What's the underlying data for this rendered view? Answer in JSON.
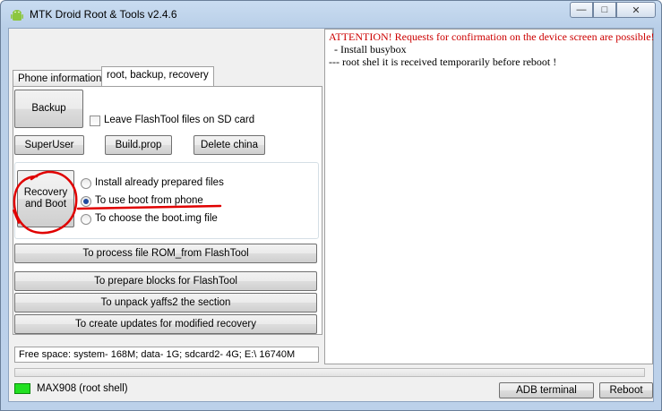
{
  "window": {
    "title": "MTK Droid Root & Tools v2.4.6"
  },
  "caption": {
    "minimize": "—",
    "maximize": "□",
    "close": "✕"
  },
  "tabs": [
    {
      "label": "Phone information"
    },
    {
      "label": "root, backup, recovery"
    }
  ],
  "panel": {
    "backup_label": "Backup",
    "leave_flashtool_label": "Leave FlashTool files on SD card",
    "superuser_label": "SuperUser",
    "buildprop_label": "Build.prop",
    "deletechina_label": "Delete china",
    "recovery_boot_label": "Recovery and Boot",
    "radio_options": [
      {
        "label": "Install already prepared files",
        "selected": false
      },
      {
        "label": "To use boot from phone",
        "selected": true
      },
      {
        "label": "To choose the boot.img file",
        "selected": false
      }
    ],
    "process_rom_label": "To process file ROM_from FlashTool",
    "prepare_blocks_label": "To prepare blocks for FlashTool",
    "unpack_yaffs2_label": "To unpack yaffs2 the section",
    "create_updates_label": "To create updates for modified recovery"
  },
  "status": {
    "free_space": "Free space: system- 168M; data- 1G; sdcard2- 4G;  E:\\ 16740M",
    "device": "MAX908 (root shell)",
    "adb_terminal_label": "ADB terminal",
    "reboot_label": "Reboot",
    "led_color": "#22e022"
  },
  "log": {
    "lines": [
      {
        "text": "ATTENTION! Requests for confirmation on the device screen are possible!",
        "color": "#cc0000"
      },
      {
        "text": "  - Install busybox",
        "color": "#000000"
      },
      {
        "text": "--- root shel it is received temporarily before reboot !",
        "color": "#000000"
      }
    ]
  },
  "annotation_color": "#e00000"
}
